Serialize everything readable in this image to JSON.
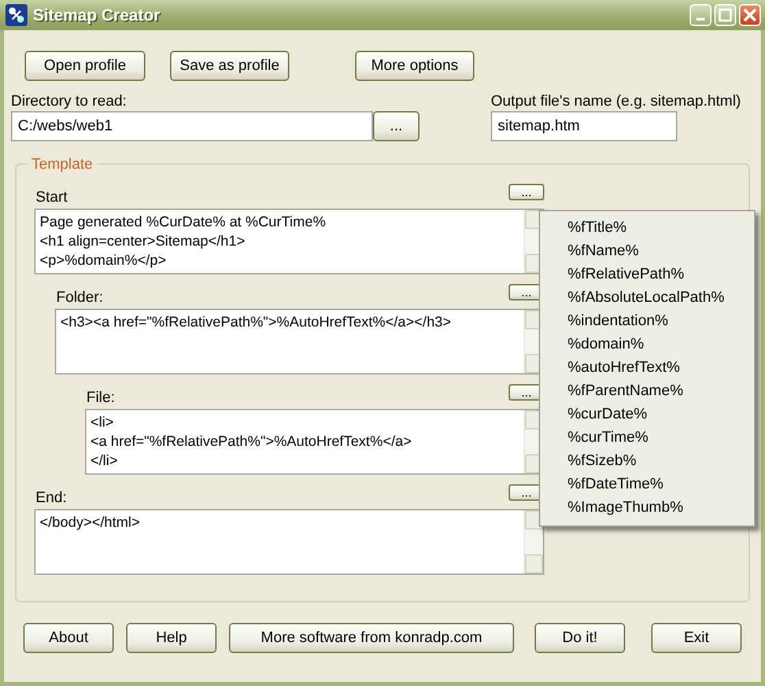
{
  "window": {
    "title": "Sitemap Creator"
  },
  "toolbar_buttons": [
    "Open profile",
    "Save as profile",
    "More options"
  ],
  "directory": {
    "label": "Directory to read:",
    "value": "C:/webs/web1",
    "browse_button": "..."
  },
  "output": {
    "label": "Output file's name (e.g. sitemap.html)",
    "value": "sitemap.htm"
  },
  "template": {
    "title": "Template",
    "sections": [
      {
        "label": "Start",
        "button": "...",
        "text": "Page generated %CurDate% at %CurTime%\n<h1 align=center>Sitemap</h1>\n<p>%domain%</p>"
      },
      {
        "label": "Folder:",
        "button": "...",
        "text": "<h3><a href=\"%fRelativePath%\">%AutoHrefText%</a></h3>"
      },
      {
        "label": "File:",
        "button": "...",
        "text": "<li>\n<a href=\"%fRelativePath%\">%AutoHrefText%</a>\n</li>"
      },
      {
        "label": "End:",
        "button": "...",
        "text": "</body></html>"
      }
    ]
  },
  "insert_menu": {
    "items": [
      "%fTitle%",
      "%fName%",
      "%fRelativePath%",
      "%fAbsoluteLocalPath%",
      "%indentation%",
      "%domain%",
      "%autoHrefText%",
      "%fParentName%",
      "%curDate%",
      "%curTime%",
      "%fSizeb%",
      "%fDateTime%",
      "%ImageThumb%"
    ]
  },
  "bottom_buttons": [
    "About",
    "Help",
    "More software from konradp.com",
    "Do it!",
    "Exit"
  ]
}
